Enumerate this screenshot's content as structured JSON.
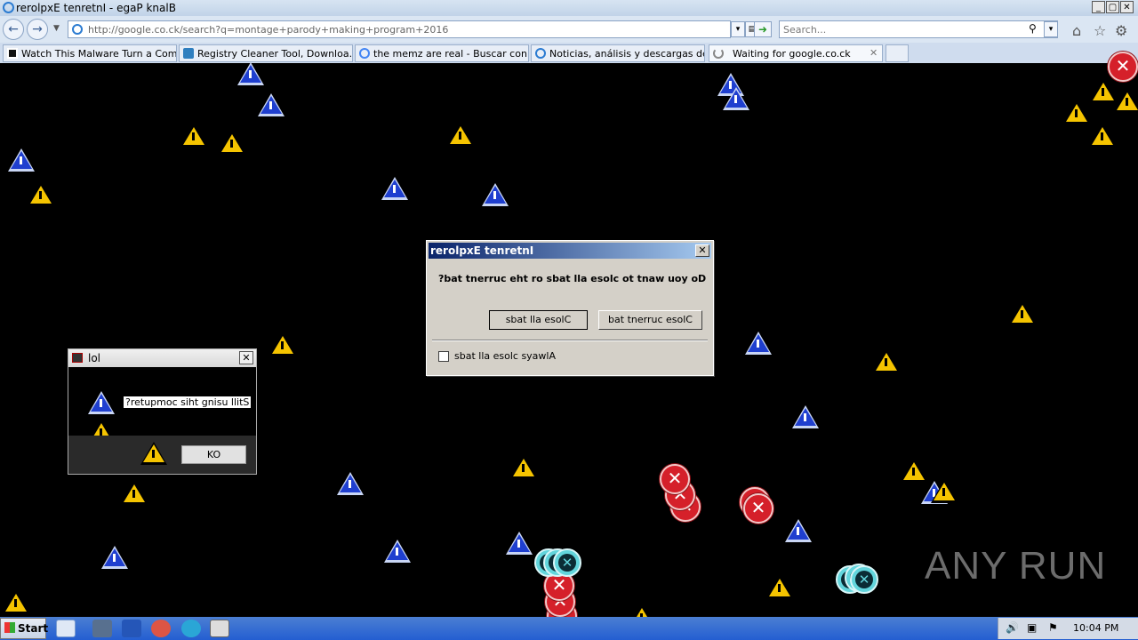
{
  "window": {
    "title": "rerolpxE tenretnI - egaP knalB"
  },
  "nav": {
    "address": "http://google.co.ck/search?q=montage+parody+making+program+2016",
    "search_placeholder": "Search..."
  },
  "tabs": [
    {
      "label": "Watch This Malware Turn a Com..."
    },
    {
      "label": "Registry Cleaner Tool, Downloa..."
    },
    {
      "label": "the memz are real - Buscar con ..."
    },
    {
      "label": "Noticias, análisis y descargas de..."
    },
    {
      "label": "Waiting for google.co.ck"
    }
  ],
  "dialog": {
    "title": "rerolpxE tenretnI",
    "message": "?bat tnerruc eht ro sbat lla esolc ot tnaw uoy oD",
    "btn_close_all": "sbat lla esolC",
    "btn_close_current": "bat tnerruc esolC",
    "checkbox_label": "sbat lla esolc syawlA"
  },
  "lol_window": {
    "title": "lol",
    "message": "?retupmoc siht gnisu llitS",
    "ok_label": "KO"
  },
  "taskbar": {
    "start_label": "Start",
    "clock": "10:04 PM"
  },
  "watermark": "ANY RUN",
  "colors": {
    "warning": "#f5c400",
    "info": "#1f3fcf",
    "error": "#d5202a",
    "cyan": "#62d5dc"
  }
}
